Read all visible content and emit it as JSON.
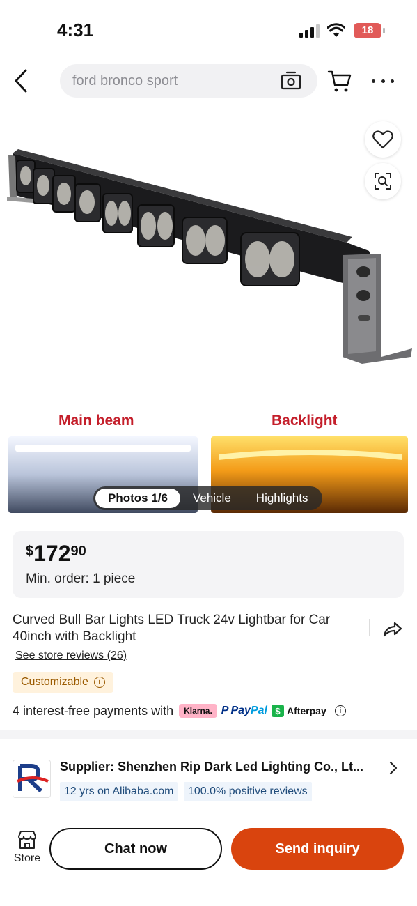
{
  "status_bar": {
    "time": "4:31",
    "battery": "18"
  },
  "search": {
    "placeholder": "ford bronco sport"
  },
  "gallery": {
    "main_beam_label": "Main beam",
    "backlight_label": "Backlight",
    "tabs": [
      {
        "label": "Photos 1/6",
        "active": true
      },
      {
        "label": "Vehicle",
        "active": false
      },
      {
        "label": "Highlights",
        "active": false
      }
    ]
  },
  "price": {
    "currency": "$",
    "integer": "172",
    "decimal": "90"
  },
  "min_order": "Min. order: 1 piece",
  "product": {
    "title": "Curved Bull Bar Lights LED Truck 24v Lightbar for Car 40inch with Backlight",
    "store_reviews": "See store reviews (26)",
    "customizable": "Customizable",
    "info_glyph": "i"
  },
  "payments": {
    "text": "4 interest-free payments with",
    "klarna": "Klarna.",
    "paypal_p": "P",
    "paypal_pay": "Pay",
    "paypal_pal": "Pal",
    "afterpay_logo": "$",
    "afterpay": "Afterpay",
    "info_glyph": "i"
  },
  "supplier": {
    "name": "Supplier: Shenzhen Rip Dark Led Lighting Co., Lt...",
    "years": "12 yrs on Alibaba.com",
    "reviews": "100.0% positive reviews"
  },
  "bottom": {
    "store_label": "Store",
    "chat": "Chat now",
    "inquiry": "Send inquiry"
  },
  "colors": {
    "accent": "#d9440e",
    "beam_label": "#c41e2a",
    "battery": "#e15a58",
    "badge_bg": "#fff2dd",
    "tag_bg": "#eef4fb"
  }
}
